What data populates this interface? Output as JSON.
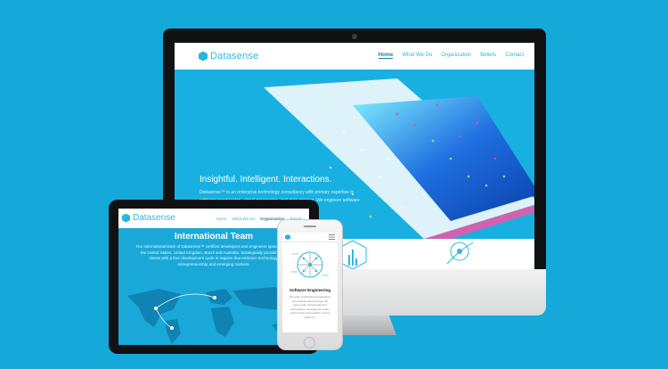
{
  "colors": {
    "accent": "#15a9d9",
    "brand": "#2bb8e6"
  },
  "desktop": {
    "logo_text": "Datasense",
    "nav": [
      "Home",
      "What We Do",
      "Organization",
      "Beliefs",
      "Contact"
    ],
    "active_nav": "Home",
    "hero_title": "Insightful. Intelligent. Interactions.",
    "hero_body": "Datasense™ is an enterprise technology consultancy with primary expertise in software engineering, signal processing, and data science. We engineer software and solutions that achieve complex business objectives."
  },
  "tablet": {
    "logo_text": "Datasense",
    "nav": [
      "Home",
      "What We Do",
      "Organization",
      "Beliefs"
    ],
    "active_nav": "Organization",
    "section_title": "International Team",
    "section_body": "Our international team of Datasense™ certified developers and engineers spans across the United States, United Kingdom, Brazil and Australia. Strategically providing our clients with a four development cycle in regions that embrace technology, entrepreneurship and emerging markets."
  },
  "phone": {
    "section_title": "Software Engineering",
    "section_body": "We build sophisticated applications and software that leverage the latest tools, frameworks and technologies, designed for scale, performance and usability across platforms."
  }
}
